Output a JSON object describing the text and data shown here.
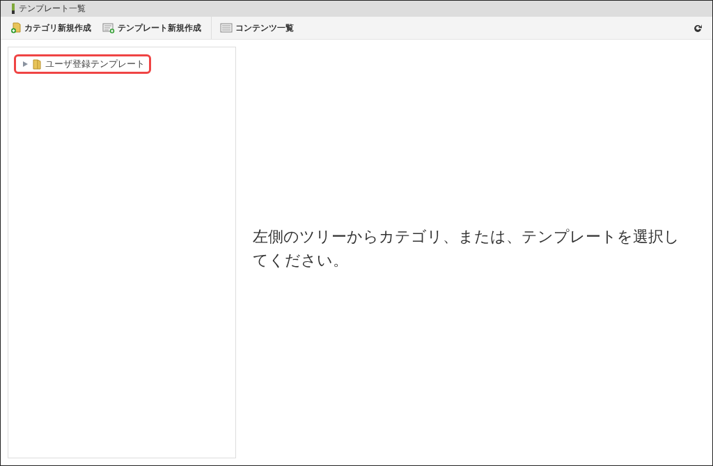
{
  "window": {
    "title": "テンプレート一覧"
  },
  "toolbar": {
    "buttons": [
      {
        "kind": "category",
        "label": "カテゴリ新規作成"
      },
      {
        "kind": "template",
        "label": "テンプレート新規作成"
      },
      {
        "kind": "list",
        "label": "コンテンツ一覧"
      }
    ]
  },
  "tree": {
    "items": [
      {
        "label": "ユーザ登録テンプレート",
        "expanded": false,
        "highlighted": true
      }
    ]
  },
  "message": "左側のツリーからカテゴリ、または、テンプレートを選択してください。"
}
